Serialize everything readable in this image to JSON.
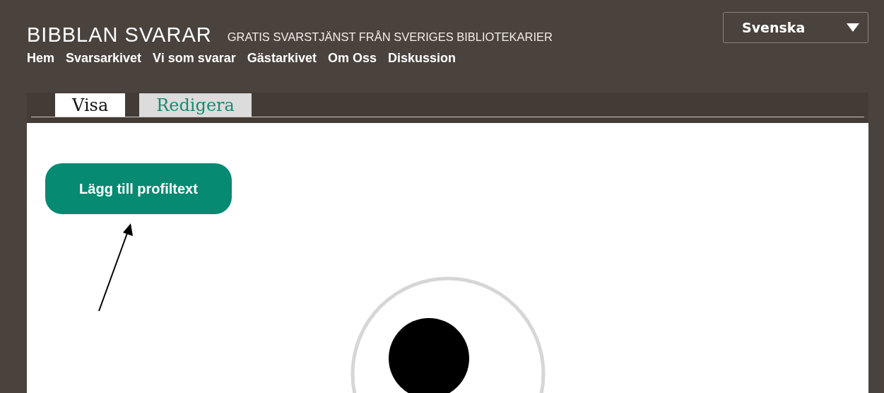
{
  "header": {
    "logo": "BIBBLAN SVARAR",
    "tagline": "GRATIS SVARSTJÄNST FRÅN SVERIGES BIBLIOTEKARIER",
    "language": "Svenska"
  },
  "nav": [
    "Hem",
    "Svarsarkivet",
    "Vi som svarar",
    "Gästarkivet",
    "Om Oss",
    "Diskussion"
  ],
  "tabs": [
    {
      "label": "Visa",
      "selected": true
    },
    {
      "label": "Redigera",
      "selected": false
    }
  ],
  "profile": {
    "add_button": "Lägg till profiltext"
  }
}
